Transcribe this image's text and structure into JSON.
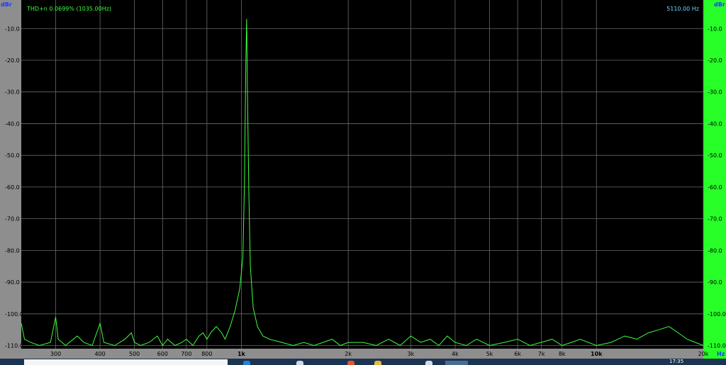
{
  "window": {
    "y_unit_left": "dBr",
    "y_unit_right": "dBr",
    "x_unit": "Hz",
    "readout_left": "THD+n 0.0699% (1035.00Hz)",
    "readout_right": "5110.00 Hz"
  },
  "colors": {
    "trace": "#3cff3c",
    "grid": "#6a6a6a",
    "plot_bg": "#000000",
    "left_axis_bg": "#8e8e8e",
    "right_axis_bg": "#28ff28",
    "x_axis_bg": "#8e8e8e",
    "readout_left": "#3cff3c",
    "readout_right": "#6fd8ff",
    "unit_label": "#1a3cff"
  },
  "taskbar": {
    "clock": "17:35",
    "icons": [
      "browser-icon",
      "media-icon",
      "firefox-icon",
      "folder-icon",
      "app-icon",
      "active-window-icon"
    ]
  },
  "chart_data": {
    "type": "line",
    "xscale": "log",
    "xlim": [
      240,
      20000
    ],
    "ylim": [
      -111,
      -1
    ],
    "y_ticks": [
      -10,
      -20,
      -30,
      -40,
      -50,
      -60,
      -70,
      -80,
      -90,
      -100,
      -110
    ],
    "y_tick_labels": [
      "-10.0",
      "-20.0",
      "-30.0",
      "-40.0",
      "-50.0",
      "-60.0",
      "-70.0",
      "-80.0",
      "-90.0",
      "-100.0",
      "-110.0"
    ],
    "x_ticks": [
      300,
      400,
      500,
      600,
      700,
      800,
      1000,
      2000,
      3000,
      4000,
      5000,
      6000,
      7000,
      8000,
      10000,
      20000
    ],
    "x_tick_labels": [
      "300",
      "400",
      "500",
      "600",
      "700",
      "800",
      "1k",
      "2k",
      "3k",
      "4k",
      "5k",
      "6k",
      "7k",
      "8k",
      "10k",
      "20k"
    ],
    "x_major_ticks": [
      "1k",
      "10k"
    ],
    "grid": true,
    "series": [
      {
        "x": [
          240,
          245,
          255,
          270,
          290,
          300,
          305,
          320,
          345,
          360,
          380,
          400,
          410,
          440,
          470,
          490,
          500,
          520,
          550,
          580,
          600,
          620,
          650,
          680,
          700,
          730,
          760,
          780,
          800,
          820,
          850,
          880,
          900,
          930,
          960,
          990,
          1010,
          1020,
          1030,
          1035,
          1040,
          1050,
          1060,
          1080,
          1110,
          1150,
          1200,
          1300,
          1400,
          1500,
          1600,
          1700,
          1800,
          1900,
          2000,
          2200,
          2400,
          2600,
          2800,
          3000,
          3200,
          3400,
          3600,
          3800,
          4000,
          4300,
          4600,
          5000,
          5500,
          6000,
          6500,
          7000,
          7500,
          8000,
          8500,
          9000,
          10000,
          11000,
          12000,
          13000,
          14000,
          15000,
          16000,
          17000,
          18000,
          19000,
          20000
        ],
        "y": [
          -103,
          -108,
          -109,
          -110,
          -109,
          -101,
          -108,
          -110,
          -107,
          -109,
          -110,
          -103,
          -109,
          -110,
          -108,
          -106,
          -109,
          -110,
          -109,
          -107,
          -110,
          -108,
          -110,
          -109,
          -108,
          -110,
          -107,
          -106,
          -108,
          -106,
          -104,
          -106,
          -108,
          -104,
          -99,
          -92,
          -82,
          -60,
          -20,
          -7,
          -28,
          -62,
          -85,
          -98,
          -104,
          -107,
          -108,
          -109,
          -110,
          -109,
          -110,
          -109,
          -108,
          -110,
          -109,
          -109,
          -110,
          -108,
          -110,
          -107,
          -109,
          -108,
          -110,
          -107,
          -109,
          -110,
          -108,
          -110,
          -109,
          -108,
          -110,
          -109,
          -108,
          -110,
          -109,
          -108,
          -110,
          -109,
          -107,
          -108,
          -106,
          -105,
          -104,
          -106,
          -108,
          -109,
          -110
        ]
      }
    ]
  }
}
